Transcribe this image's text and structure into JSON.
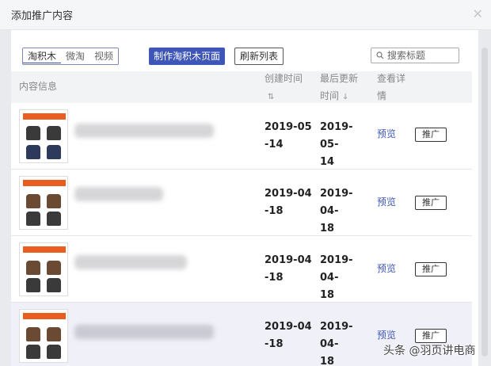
{
  "dialog": {
    "title": "添加推广内容",
    "close_icon": "close-icon"
  },
  "toolbar": {
    "tabs": [
      {
        "label": "淘积木",
        "active": true
      },
      {
        "label": "微淘",
        "active": false
      },
      {
        "label": "视频",
        "active": false
      }
    ],
    "make_page_label": "制作淘积木页面",
    "refresh_label": "刷新列表"
  },
  "search": {
    "placeholder": "搜索标题",
    "icon": "search-icon"
  },
  "table": {
    "headers": {
      "info": "内容信息",
      "created_line1": "创建时间",
      "created_sort": "⇅",
      "updated_line1": "最后更新",
      "updated_line2": "时间",
      "updated_sort": "↓",
      "detail_line1": "查看详",
      "detail_line2": "情"
    },
    "rows": [
      {
        "created_1": "2019-05",
        "created_2": "-14",
        "updated_1": "2019-05-",
        "updated_2": "14",
        "preview": "预览",
        "promote": "推广"
      },
      {
        "created_1": "2019-04",
        "created_2": "-18",
        "updated_1": "2019-04-",
        "updated_2": "18",
        "preview": "预览",
        "promote": "推广"
      },
      {
        "created_1": "2019-04",
        "created_2": "-18",
        "updated_1": "2019-04-",
        "updated_2": "18",
        "preview": "预览",
        "promote": "推广"
      },
      {
        "created_1": "2019-04",
        "created_2": "-18",
        "updated_1": "2019-04-",
        "updated_2": "18",
        "preview": "预览",
        "promote": "推广"
      }
    ]
  },
  "watermark": "头条 @羽页讲电商",
  "colors": {
    "primary": "#3d56b8",
    "thumb_banner": "#e95d1e",
    "highlight_row": "#f0f1f8"
  }
}
